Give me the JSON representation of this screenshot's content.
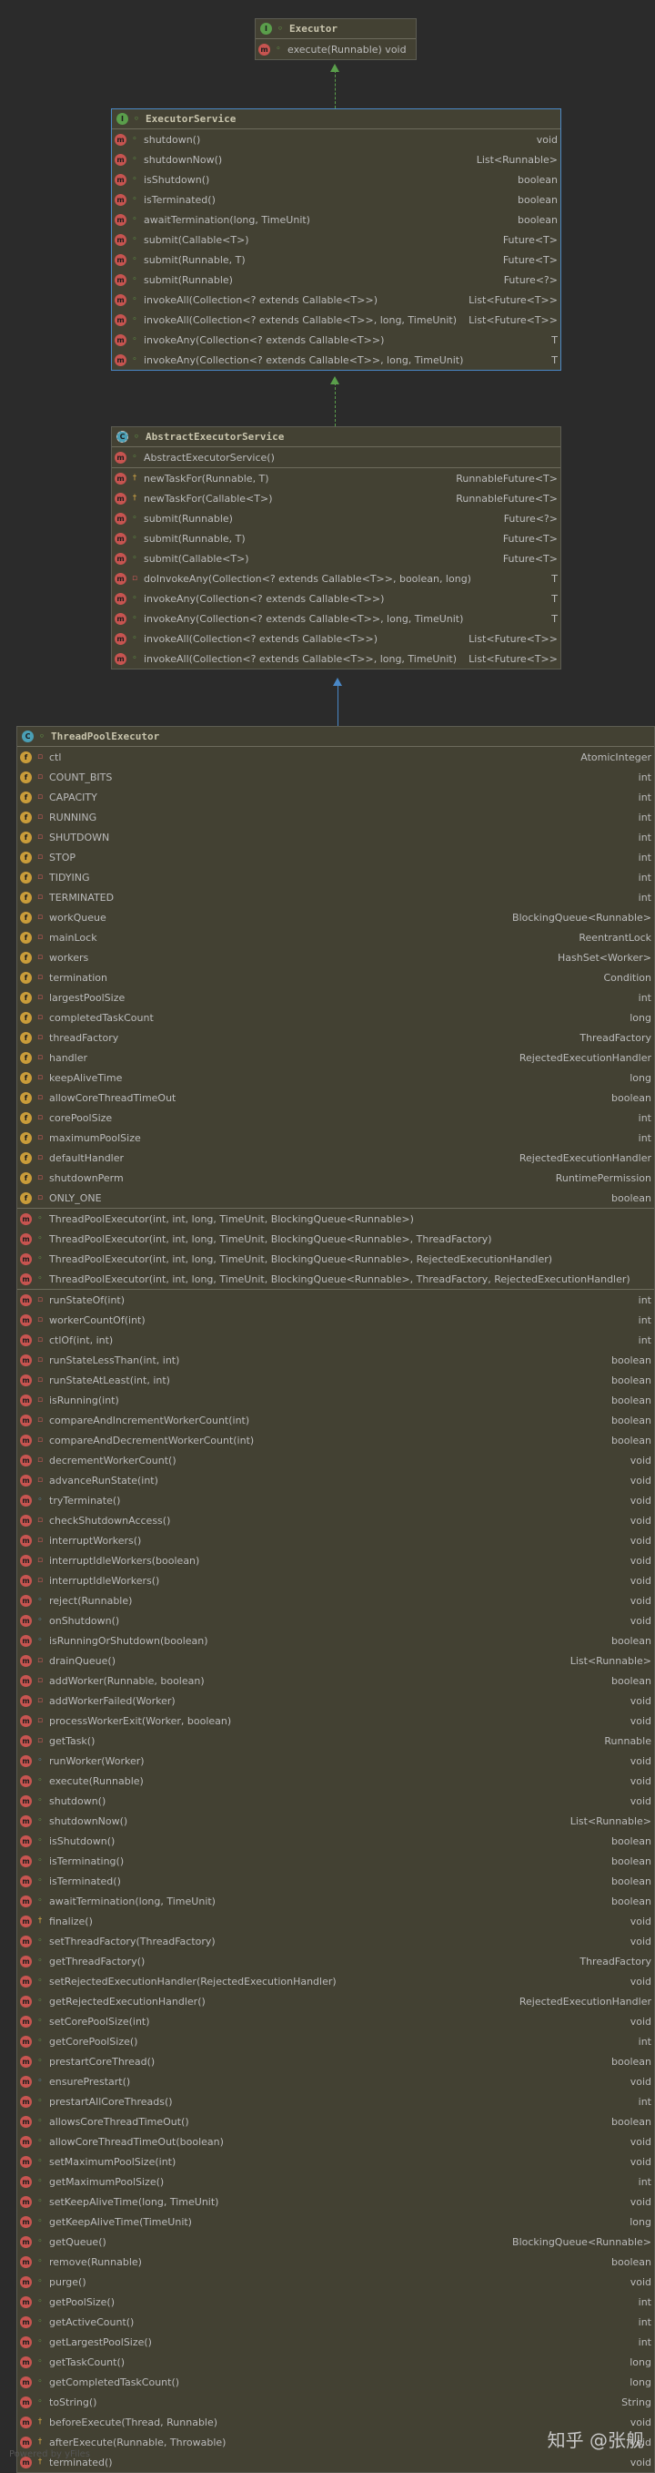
{
  "executor": {
    "name": "Executor",
    "kind": "interface",
    "methods": [
      {
        "label": "execute(Runnable) void",
        "type": ""
      }
    ]
  },
  "executor_service": {
    "name": "ExecutorService",
    "kind": "interface",
    "methods": [
      {
        "label": "shutdown()",
        "type": "void"
      },
      {
        "label": "shutdownNow()",
        "type": "List<Runnable>"
      },
      {
        "label": "isShutdown()",
        "type": "boolean"
      },
      {
        "label": "isTerminated()",
        "type": "boolean"
      },
      {
        "label": "awaitTermination(long, TimeUnit)",
        "type": "boolean"
      },
      {
        "label": "submit(Callable<T>)",
        "type": "Future<T>"
      },
      {
        "label": "submit(Runnable, T)",
        "type": "Future<T>"
      },
      {
        "label": "submit(Runnable)",
        "type": "Future<?>"
      },
      {
        "label": "invokeAll(Collection<? extends Callable<T>>)",
        "type": "List<Future<T>>"
      },
      {
        "label": "invokeAll(Collection<? extends Callable<T>>, long, TimeUnit)",
        "type": "List<Future<T>>"
      },
      {
        "label": "invokeAny(Collection<? extends Callable<T>>)",
        "type": "T"
      },
      {
        "label": "invokeAny(Collection<? extends Callable<T>>, long, TimeUnit)",
        "type": "T"
      }
    ]
  },
  "abstract_executor_service": {
    "name": "AbstractExecutorService",
    "kind": "abstract-class",
    "constructors": [
      {
        "label": "AbstractExecutorService()",
        "type": ""
      }
    ],
    "methods": [
      {
        "label": "newTaskFor(Runnable, T)",
        "type": "RunnableFuture<T>",
        "vis": "prot"
      },
      {
        "label": "newTaskFor(Callable<T>)",
        "type": "RunnableFuture<T>",
        "vis": "prot"
      },
      {
        "label": "submit(Runnable)",
        "type": "Future<?>",
        "vis": "pub"
      },
      {
        "label": "submit(Runnable, T)",
        "type": "Future<T>",
        "vis": "pub"
      },
      {
        "label": "submit(Callable<T>)",
        "type": "Future<T>",
        "vis": "pub"
      },
      {
        "label": "doInvokeAny(Collection<? extends Callable<T>>, boolean, long)",
        "type": "T",
        "vis": "priv"
      },
      {
        "label": "invokeAny(Collection<? extends Callable<T>>)",
        "type": "T",
        "vis": "pub"
      },
      {
        "label": "invokeAny(Collection<? extends Callable<T>>, long, TimeUnit)",
        "type": "T",
        "vis": "pub"
      },
      {
        "label": "invokeAll(Collection<? extends Callable<T>>)",
        "type": "List<Future<T>>",
        "vis": "pub"
      },
      {
        "label": "invokeAll(Collection<? extends Callable<T>>, long, TimeUnit)",
        "type": "List<Future<T>>",
        "vis": "pub"
      }
    ]
  },
  "thread_pool_executor": {
    "name": "ThreadPoolExecutor",
    "kind": "class",
    "fields": [
      {
        "label": "ctl",
        "type": "AtomicInteger",
        "vis": "priv"
      },
      {
        "label": "COUNT_BITS",
        "type": "int",
        "vis": "priv"
      },
      {
        "label": "CAPACITY",
        "type": "int",
        "vis": "priv"
      },
      {
        "label": "RUNNING",
        "type": "int",
        "vis": "priv"
      },
      {
        "label": "SHUTDOWN",
        "type": "int",
        "vis": "priv"
      },
      {
        "label": "STOP",
        "type": "int",
        "vis": "priv"
      },
      {
        "label": "TIDYING",
        "type": "int",
        "vis": "priv"
      },
      {
        "label": "TERMINATED",
        "type": "int",
        "vis": "priv"
      },
      {
        "label": "workQueue",
        "type": "BlockingQueue<Runnable>",
        "vis": "priv"
      },
      {
        "label": "mainLock",
        "type": "ReentrantLock",
        "vis": "priv"
      },
      {
        "label": "workers",
        "type": "HashSet<Worker>",
        "vis": "priv"
      },
      {
        "label": "termination",
        "type": "Condition",
        "vis": "priv"
      },
      {
        "label": "largestPoolSize",
        "type": "int",
        "vis": "priv"
      },
      {
        "label": "completedTaskCount",
        "type": "long",
        "vis": "priv"
      },
      {
        "label": "threadFactory",
        "type": "ThreadFactory",
        "vis": "priv"
      },
      {
        "label": "handler",
        "type": "RejectedExecutionHandler",
        "vis": "priv"
      },
      {
        "label": "keepAliveTime",
        "type": "long",
        "vis": "priv"
      },
      {
        "label": "allowCoreThreadTimeOut",
        "type": "boolean",
        "vis": "priv"
      },
      {
        "label": "corePoolSize",
        "type": "int",
        "vis": "priv"
      },
      {
        "label": "maximumPoolSize",
        "type": "int",
        "vis": "priv"
      },
      {
        "label": "defaultHandler",
        "type": "RejectedExecutionHandler",
        "vis": "priv"
      },
      {
        "label": "shutdownPerm",
        "type": "RuntimePermission",
        "vis": "priv"
      },
      {
        "label": "ONLY_ONE",
        "type": "boolean",
        "vis": "priv"
      }
    ],
    "constructors": [
      {
        "label": "ThreadPoolExecutor(int, int, long, TimeUnit, BlockingQueue<Runnable>)",
        "type": ""
      },
      {
        "label": "ThreadPoolExecutor(int, int, long, TimeUnit, BlockingQueue<Runnable>, ThreadFactory)",
        "type": ""
      },
      {
        "label": "ThreadPoolExecutor(int, int, long, TimeUnit, BlockingQueue<Runnable>, RejectedExecutionHandler)",
        "type": ""
      },
      {
        "label": "ThreadPoolExecutor(int, int, long, TimeUnit, BlockingQueue<Runnable>, ThreadFactory, RejectedExecutionHandler)",
        "type": ""
      }
    ],
    "methods": [
      {
        "label": "runStateOf(int)",
        "type": "int",
        "vis": "priv"
      },
      {
        "label": "workerCountOf(int)",
        "type": "int",
        "vis": "priv"
      },
      {
        "label": "ctlOf(int, int)",
        "type": "int",
        "vis": "priv"
      },
      {
        "label": "runStateLessThan(int, int)",
        "type": "boolean",
        "vis": "priv"
      },
      {
        "label": "runStateAtLeast(int, int)",
        "type": "boolean",
        "vis": "priv"
      },
      {
        "label": "isRunning(int)",
        "type": "boolean",
        "vis": "priv"
      },
      {
        "label": "compareAndIncrementWorkerCount(int)",
        "type": "boolean",
        "vis": "priv"
      },
      {
        "label": "compareAndDecrementWorkerCount(int)",
        "type": "boolean",
        "vis": "priv"
      },
      {
        "label": "decrementWorkerCount()",
        "type": "void",
        "vis": "priv"
      },
      {
        "label": "advanceRunState(int)",
        "type": "void",
        "vis": "priv"
      },
      {
        "label": "tryTerminate()",
        "type": "void",
        "vis": "pkg"
      },
      {
        "label": "checkShutdownAccess()",
        "type": "void",
        "vis": "priv"
      },
      {
        "label": "interruptWorkers()",
        "type": "void",
        "vis": "priv"
      },
      {
        "label": "interruptIdleWorkers(boolean)",
        "type": "void",
        "vis": "priv"
      },
      {
        "label": "interruptIdleWorkers()",
        "type": "void",
        "vis": "priv"
      },
      {
        "label": "reject(Runnable)",
        "type": "void",
        "vis": "pkg"
      },
      {
        "label": "onShutdown()",
        "type": "void",
        "vis": "pkg"
      },
      {
        "label": "isRunningOrShutdown(boolean)",
        "type": "boolean",
        "vis": "pkg"
      },
      {
        "label": "drainQueue()",
        "type": "List<Runnable>",
        "vis": "priv"
      },
      {
        "label": "addWorker(Runnable, boolean)",
        "type": "boolean",
        "vis": "priv"
      },
      {
        "label": "addWorkerFailed(Worker)",
        "type": "void",
        "vis": "priv"
      },
      {
        "label": "processWorkerExit(Worker, boolean)",
        "type": "void",
        "vis": "priv"
      },
      {
        "label": "getTask()",
        "type": "Runnable",
        "vis": "priv"
      },
      {
        "label": "runWorker(Worker)",
        "type": "void",
        "vis": "pkg"
      },
      {
        "label": "execute(Runnable)",
        "type": "void",
        "vis": "pub"
      },
      {
        "label": "shutdown()",
        "type": "void",
        "vis": "pub"
      },
      {
        "label": "shutdownNow()",
        "type": "List<Runnable>",
        "vis": "pub"
      },
      {
        "label": "isShutdown()",
        "type": "boolean",
        "vis": "pub"
      },
      {
        "label": "isTerminating()",
        "type": "boolean",
        "vis": "pub"
      },
      {
        "label": "isTerminated()",
        "type": "boolean",
        "vis": "pub"
      },
      {
        "label": "awaitTermination(long, TimeUnit)",
        "type": "boolean",
        "vis": "pub"
      },
      {
        "label": "finalize()",
        "type": "void",
        "vis": "prot"
      },
      {
        "label": "setThreadFactory(ThreadFactory)",
        "type": "void",
        "vis": "pub"
      },
      {
        "label": "getThreadFactory()",
        "type": "ThreadFactory",
        "vis": "pub"
      },
      {
        "label": "setRejectedExecutionHandler(RejectedExecutionHandler)",
        "type": "void",
        "vis": "pub"
      },
      {
        "label": "getRejectedExecutionHandler()",
        "type": "RejectedExecutionHandler",
        "vis": "pub"
      },
      {
        "label": "setCorePoolSize(int)",
        "type": "void",
        "vis": "pub"
      },
      {
        "label": "getCorePoolSize()",
        "type": "int",
        "vis": "pub"
      },
      {
        "label": "prestartCoreThread()",
        "type": "boolean",
        "vis": "pub"
      },
      {
        "label": "ensurePrestart()",
        "type": "void",
        "vis": "pkg"
      },
      {
        "label": "prestartAllCoreThreads()",
        "type": "int",
        "vis": "pub"
      },
      {
        "label": "allowsCoreThreadTimeOut()",
        "type": "boolean",
        "vis": "pub"
      },
      {
        "label": "allowCoreThreadTimeOut(boolean)",
        "type": "void",
        "vis": "pub"
      },
      {
        "label": "setMaximumPoolSize(int)",
        "type": "void",
        "vis": "pub"
      },
      {
        "label": "getMaximumPoolSize()",
        "type": "int",
        "vis": "pub"
      },
      {
        "label": "setKeepAliveTime(long, TimeUnit)",
        "type": "void",
        "vis": "pub"
      },
      {
        "label": "getKeepAliveTime(TimeUnit)",
        "type": "long",
        "vis": "pub"
      },
      {
        "label": "getQueue()",
        "type": "BlockingQueue<Runnable>",
        "vis": "pub"
      },
      {
        "label": "remove(Runnable)",
        "type": "boolean",
        "vis": "pub"
      },
      {
        "label": "purge()",
        "type": "void",
        "vis": "pub"
      },
      {
        "label": "getPoolSize()",
        "type": "int",
        "vis": "pub"
      },
      {
        "label": "getActiveCount()",
        "type": "int",
        "vis": "pub"
      },
      {
        "label": "getLargestPoolSize()",
        "type": "int",
        "vis": "pub"
      },
      {
        "label": "getTaskCount()",
        "type": "long",
        "vis": "pub"
      },
      {
        "label": "getCompletedTaskCount()",
        "type": "long",
        "vis": "pub"
      },
      {
        "label": "toString()",
        "type": "String",
        "vis": "pub"
      },
      {
        "label": "beforeExecute(Thread, Runnable)",
        "type": "void",
        "vis": "prot"
      },
      {
        "label": "afterExecute(Runnable, Throwable)",
        "type": "void",
        "vis": "prot"
      },
      {
        "label": "terminated()",
        "type": "void",
        "vis": "prot"
      }
    ]
  },
  "footer": {
    "left": "Powered by yFiles",
    "right": "知乎 @张舰"
  },
  "colors": {
    "background": "#2b2b2b",
    "box": "#434133",
    "selected_border": "#4a88c7",
    "interface_arrow": "#5a9e4b",
    "class_arrow": "#4a88c7"
  }
}
